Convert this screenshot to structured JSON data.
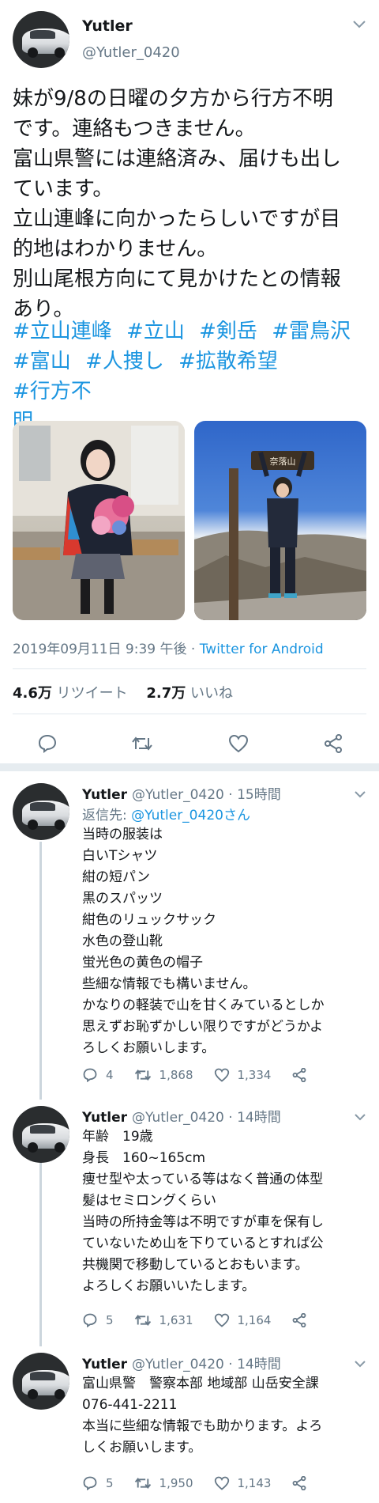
{
  "main_tweet": {
    "display_name": "Yutler",
    "handle": "@Yutler_0420",
    "text": "妹が9/8の日曜の夕方から行方不明\nです。連絡もつきません。\n富山県警には連絡済み、届けも出し\nています。\n立山連峰に向かったらしいですが目\n的地はわかりません。\n別山尾根方向にて見かけたとの情報\nあり。",
    "hashtags": [
      "#立山連峰",
      "#立山",
      "#剣岳",
      "#雷鳥沢",
      "#富山",
      "#人捜し",
      "#拡散希望",
      "#行方不\n明"
    ],
    "photo_sign": "奈落山",
    "timestamp": "2019年09月11日 9:39 午後",
    "separator": "·",
    "source": "Twitter for Android",
    "retweets_count": "4.6万",
    "retweets_label": "リツイート",
    "likes_count": "2.7万",
    "likes_label": "いいね"
  },
  "replies": [
    {
      "display_name": "Yutler",
      "handle": "@Yutler_0420",
      "time": "· 15時間",
      "reply_to_label": "返信先:",
      "reply_to_handle": "@Yutler_0420さん",
      "text": "当時の服装は\n白いTシャツ\n紺の短パン\n黒のスパッツ\n紺色のリュックサック\n水色の登山靴\n蛍光色の黄色の帽子\n些細な情報でも構いません。\nかなりの軽装で山を甘くみているとしか\n思えずお恥ずかしい限りですがどうかよ\nろしくお願いします。",
      "replies": "4",
      "retweets": "1,868",
      "likes": "1,334"
    },
    {
      "display_name": "Yutler",
      "handle": "@Yutler_0420",
      "time": "· 14時間",
      "text": "年齢　19歳\n身長　160~165cm\n痩せ型や太っている等はなく普通の体型\n髪はセミロングくらい\n当時の所持金等は不明ですが車を保有し\nていないため山を下りているとすれば公\n共機関で移動しているとおもいます。\nよろしくお願いいたします。",
      "replies": "5",
      "retweets": "1,631",
      "likes": "1,164"
    },
    {
      "display_name": "Yutler",
      "handle": "@Yutler_0420",
      "time": "· 14時間",
      "text": "富山県警　警察本部 地域部 山岳安全課\n076-441-2211\n本当に些細な情報でも助かります。よろ\nしくお願いします。",
      "replies": "5",
      "retweets": "1,950",
      "likes": "1,143"
    }
  ],
  "colors": {
    "link": "#1b95e0",
    "secondary_text": "#657786",
    "primary_text": "#14171a",
    "divider": "#e1e8ed"
  },
  "icons": [
    "chevron-down-icon",
    "reply-icon",
    "retweet-icon",
    "like-icon",
    "share-icon"
  ]
}
